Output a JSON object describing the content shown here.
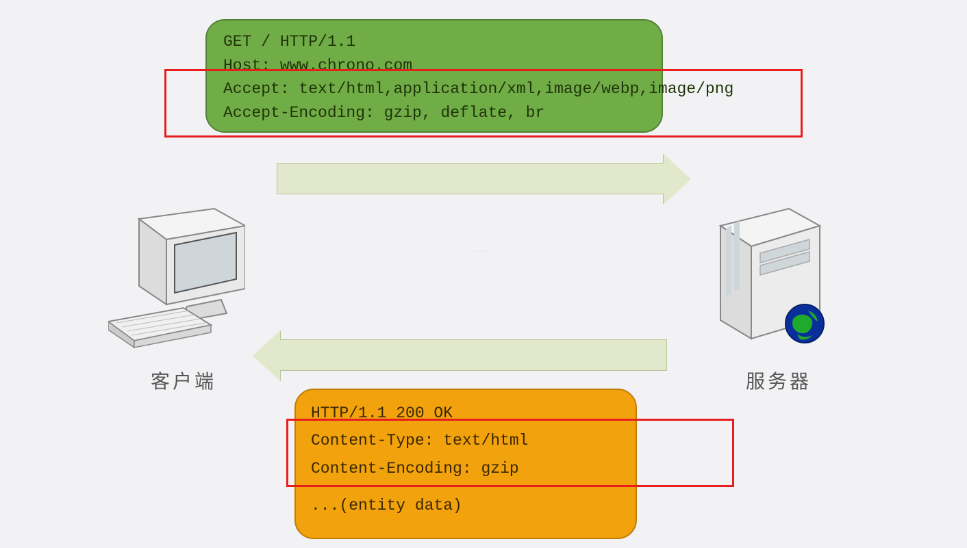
{
  "request": {
    "line1": "GET / HTTP/1.1",
    "line2": "Host: www.chrono.com",
    "line3": "Accept: text/html,application/xml,image/webp,image/png",
    "line4": "Accept-Encoding: gzip, deflate, br"
  },
  "response": {
    "line1": "HTTP/1.1 200 OK",
    "line2": "Content-Type: text/html",
    "line3": "Content-Encoding: gzip",
    "line4": "...(entity data)"
  },
  "labels": {
    "client": "客户端",
    "server": "服务器"
  },
  "colors": {
    "request_bg": "#70ad47",
    "response_bg": "#f1a20c",
    "highlight": "#e81e1e",
    "arrow": "#e1e8cb"
  }
}
